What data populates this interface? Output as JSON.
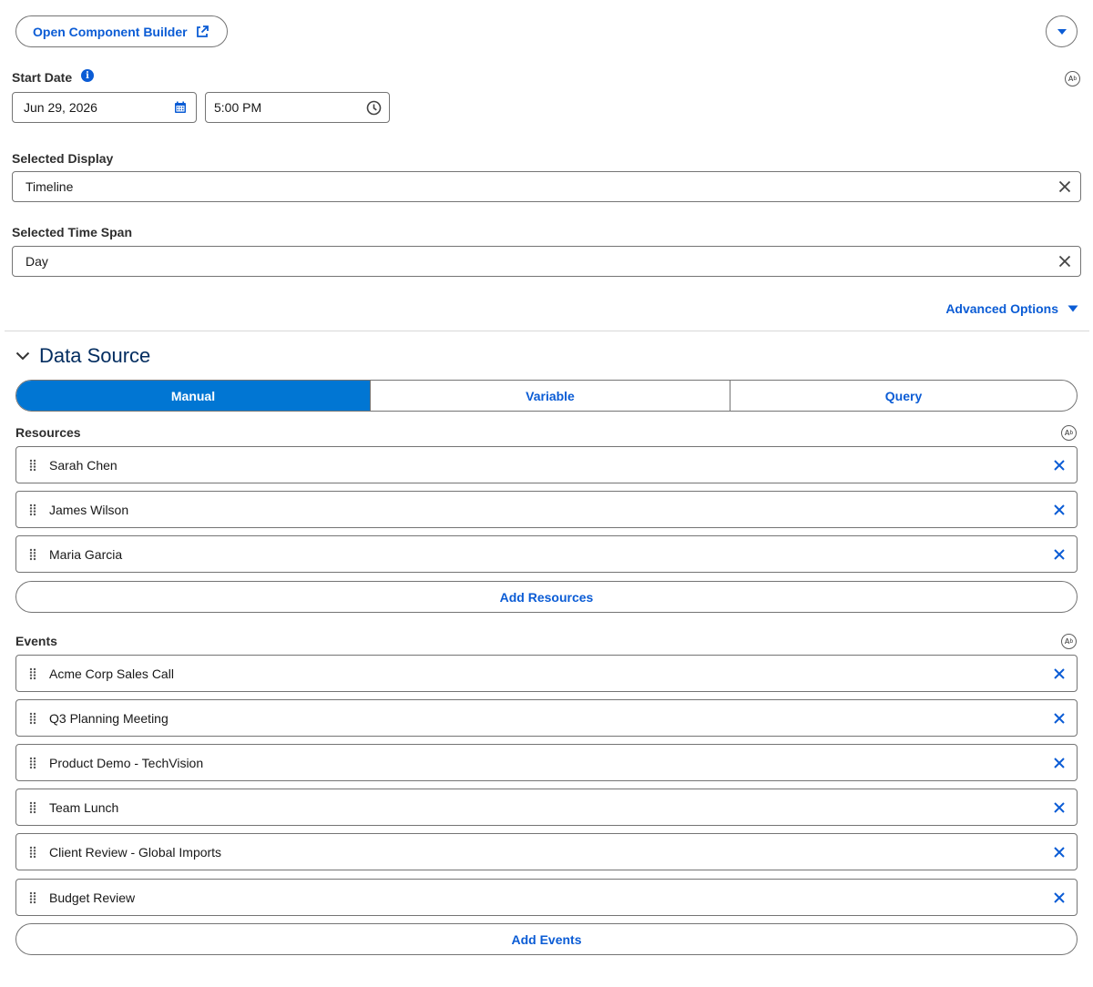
{
  "top": {
    "open_builder_label": "Open Component Builder",
    "icons": {
      "external": "external-link-icon",
      "dropdown": "chevron-down-icon"
    }
  },
  "start_date": {
    "label": "Start Date",
    "info_icon_glyph": "i",
    "date_value": "Jun 29, 2026",
    "time_value": "5:00 PM"
  },
  "selected_display": {
    "label": "Selected Display",
    "value": "Timeline"
  },
  "selected_time_span": {
    "label": "Selected Time Span",
    "value": "Day"
  },
  "advanced_options_label": "Advanced Options",
  "data_source": {
    "title": "Data Source",
    "tabs": [
      {
        "label": "Manual",
        "active": true
      },
      {
        "label": "Variable",
        "active": false
      },
      {
        "label": "Query",
        "active": false
      }
    ]
  },
  "resources": {
    "label": "Resources",
    "items": [
      "Sarah Chen",
      "James Wilson",
      "Maria Garcia"
    ],
    "add_label": "Add Resources"
  },
  "events": {
    "label": "Events",
    "items": [
      "Acme Corp Sales Call",
      "Q3 Planning Meeting",
      "Product Demo - TechVision",
      "Team Lunch",
      "Client Review - Global Imports",
      "Budget Review"
    ],
    "add_label": "Add Events"
  },
  "colors": {
    "brand": "#0b5cd5",
    "active_tab": "#0176d3",
    "heading": "#032d60",
    "border": "#747474"
  }
}
